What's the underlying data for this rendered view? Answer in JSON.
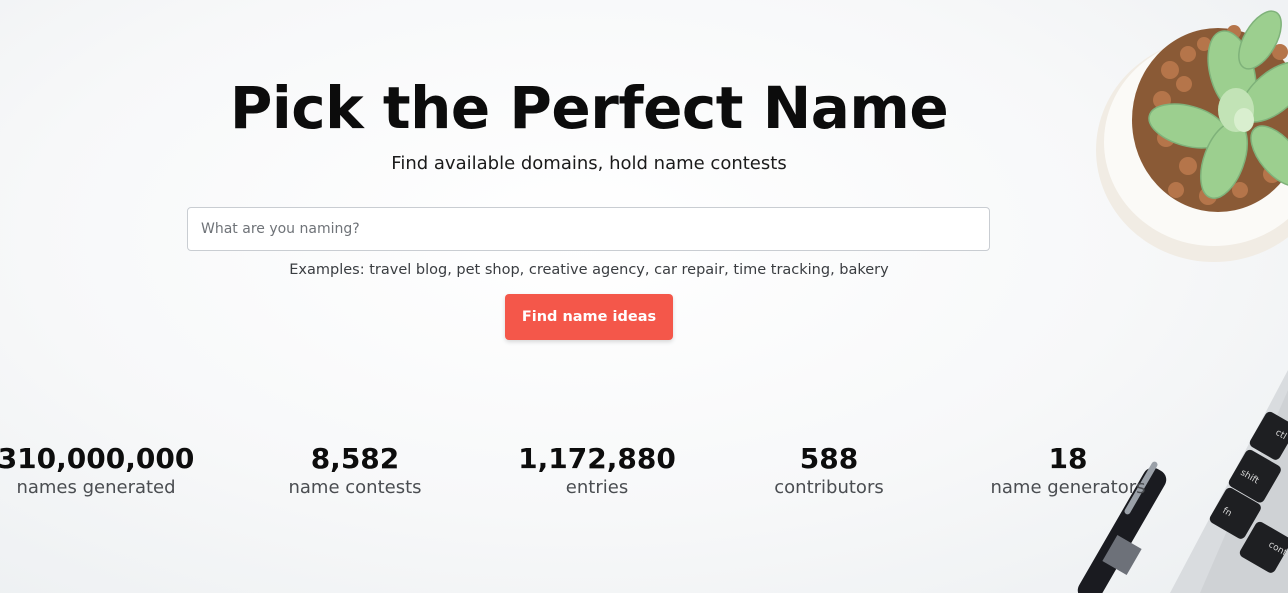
{
  "hero": {
    "title": "Pick the Perfect Name",
    "subtitle": "Find available domains, hold name contests",
    "search_placeholder": "What are you naming?",
    "examples": "Examples: travel blog, pet shop, creative agency, car repair, time tracking, bakery",
    "cta_label": "Find name ideas"
  },
  "stats": [
    {
      "value": "310,000,000",
      "label": "names generated"
    },
    {
      "value": "8,582",
      "label": "name contests"
    },
    {
      "value": "1,172,880",
      "label": "entries"
    },
    {
      "value": "588",
      "label": "contributors"
    },
    {
      "value": "18",
      "label": "name generators"
    }
  ],
  "colors": {
    "accent": "#f4574a",
    "background": "#f5f6f7"
  },
  "decor": {
    "plant": "succulent-plant-image",
    "laptop": "laptop-keyboard-image",
    "pen": "pen-image"
  }
}
